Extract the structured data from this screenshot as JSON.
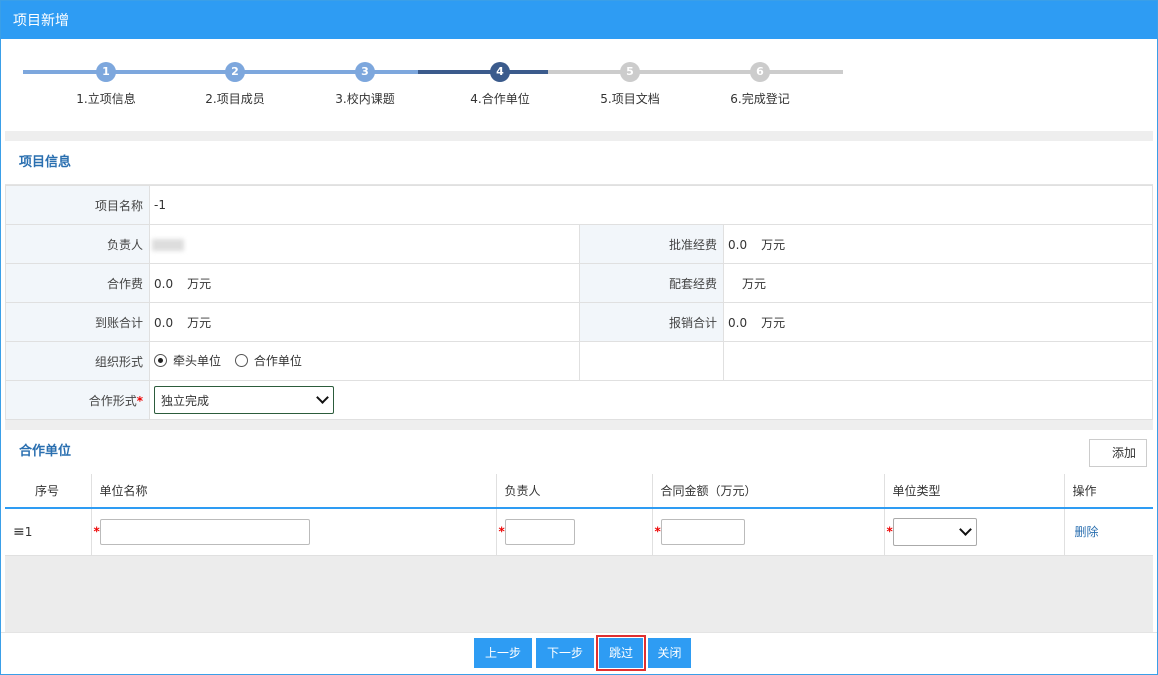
{
  "window": {
    "title": "项目新增"
  },
  "steps": [
    {
      "num": "1",
      "label": "1.立项信息"
    },
    {
      "num": "2",
      "label": "2.项目成员"
    },
    {
      "num": "3",
      "label": "3.校内课题"
    },
    {
      "num": "4",
      "label": "4.合作单位"
    },
    {
      "num": "5",
      "label": "5.项目文档"
    },
    {
      "num": "6",
      "label": "6.完成登记"
    }
  ],
  "colors": {
    "accent": "#2e9cf3",
    "step_done": "#7da7dd",
    "step_active": "#3b5b8c",
    "step_todo": "#cccccc",
    "title_text": "#2a6fb0"
  },
  "info": {
    "section_title": "项目信息",
    "project_name_label": "项目名称",
    "project_name_value": "-1",
    "leader_label": "负责人",
    "approved_funds_label": "批准经费",
    "approved_funds_value": "0.0",
    "coop_fee_label": "合作费",
    "coop_fee_value": "0.0",
    "matching_funds_label": "配套经费",
    "matching_funds_value": "",
    "received_total_label": "到账合计",
    "received_total_value": "0.0",
    "reimbursed_total_label": "报销合计",
    "reimbursed_total_value": "0.0",
    "unit": "万元",
    "org_form_label": "组织形式",
    "org_form_options": [
      "牵头单位",
      "合作单位"
    ],
    "coop_form_label": "合作形式",
    "coop_form_value": "独立完成"
  },
  "units": {
    "section_title": "合作单位",
    "add_label": "添加",
    "columns": [
      "序号",
      "单位名称",
      "负责人",
      "合同金额（万元）",
      "单位类型",
      "操作"
    ],
    "rows": [
      {
        "index": "1",
        "action": "删除"
      }
    ]
  },
  "footer": {
    "prev": "上一步",
    "next": "下一步",
    "skip": "跳过",
    "close": "关闭"
  }
}
